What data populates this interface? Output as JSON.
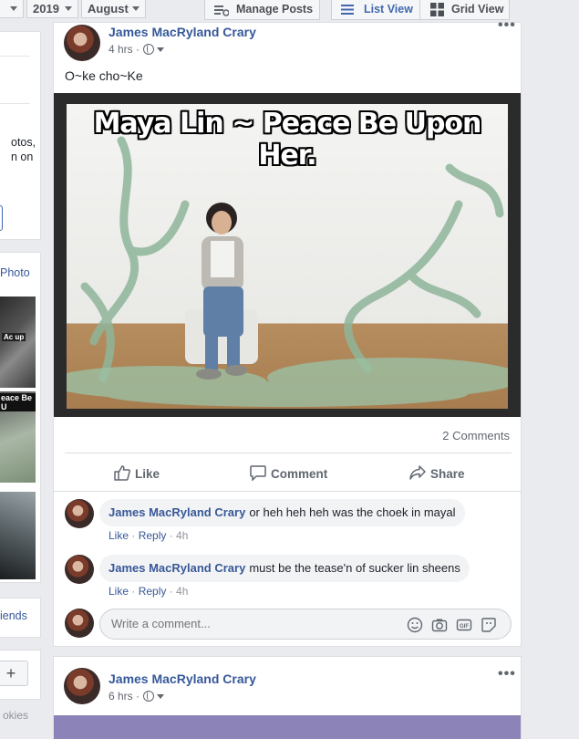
{
  "toolbar": {
    "month_select": "",
    "year_select": "2019",
    "month2_select": "August",
    "manage_posts": "Manage Posts",
    "list_view": "List View",
    "grid_view": "Grid View"
  },
  "left": {
    "text_fragment_1": "otos,",
    "text_fragment_2": "n on",
    "photos_link": "Photo",
    "friends_link": "iends",
    "plus": "+",
    "cookies": "okies",
    "thumb_label_1": "Ac up",
    "thumb_label_2": "eace Be U"
  },
  "post1": {
    "author": "James MacRyland Crary",
    "time": "4 hrs",
    "text": "O~ke cho~Ke",
    "image_caption": "Maya Lin ~ Peace Be Upon Her.",
    "comment_count": "2 Comments",
    "actions": {
      "like": "Like",
      "comment": "Comment",
      "share": "Share"
    },
    "comments": [
      {
        "author": "James MacRyland Crary",
        "text": "or heh heh heh was the choek in mayal",
        "like": "Like",
        "reply": "Reply",
        "time": "4h"
      },
      {
        "author": "James MacRyland Crary",
        "text": "must be the tease'n of sucker lin sheens",
        "like": "Like",
        "reply": "Reply",
        "time": "4h"
      }
    ],
    "write_placeholder": "Write a comment..."
  },
  "post2": {
    "author": "James MacRyland Crary",
    "time": "6 hrs"
  },
  "colors": {
    "link": "#365899",
    "accent": "#4267b2",
    "background": "#e9ebee"
  }
}
